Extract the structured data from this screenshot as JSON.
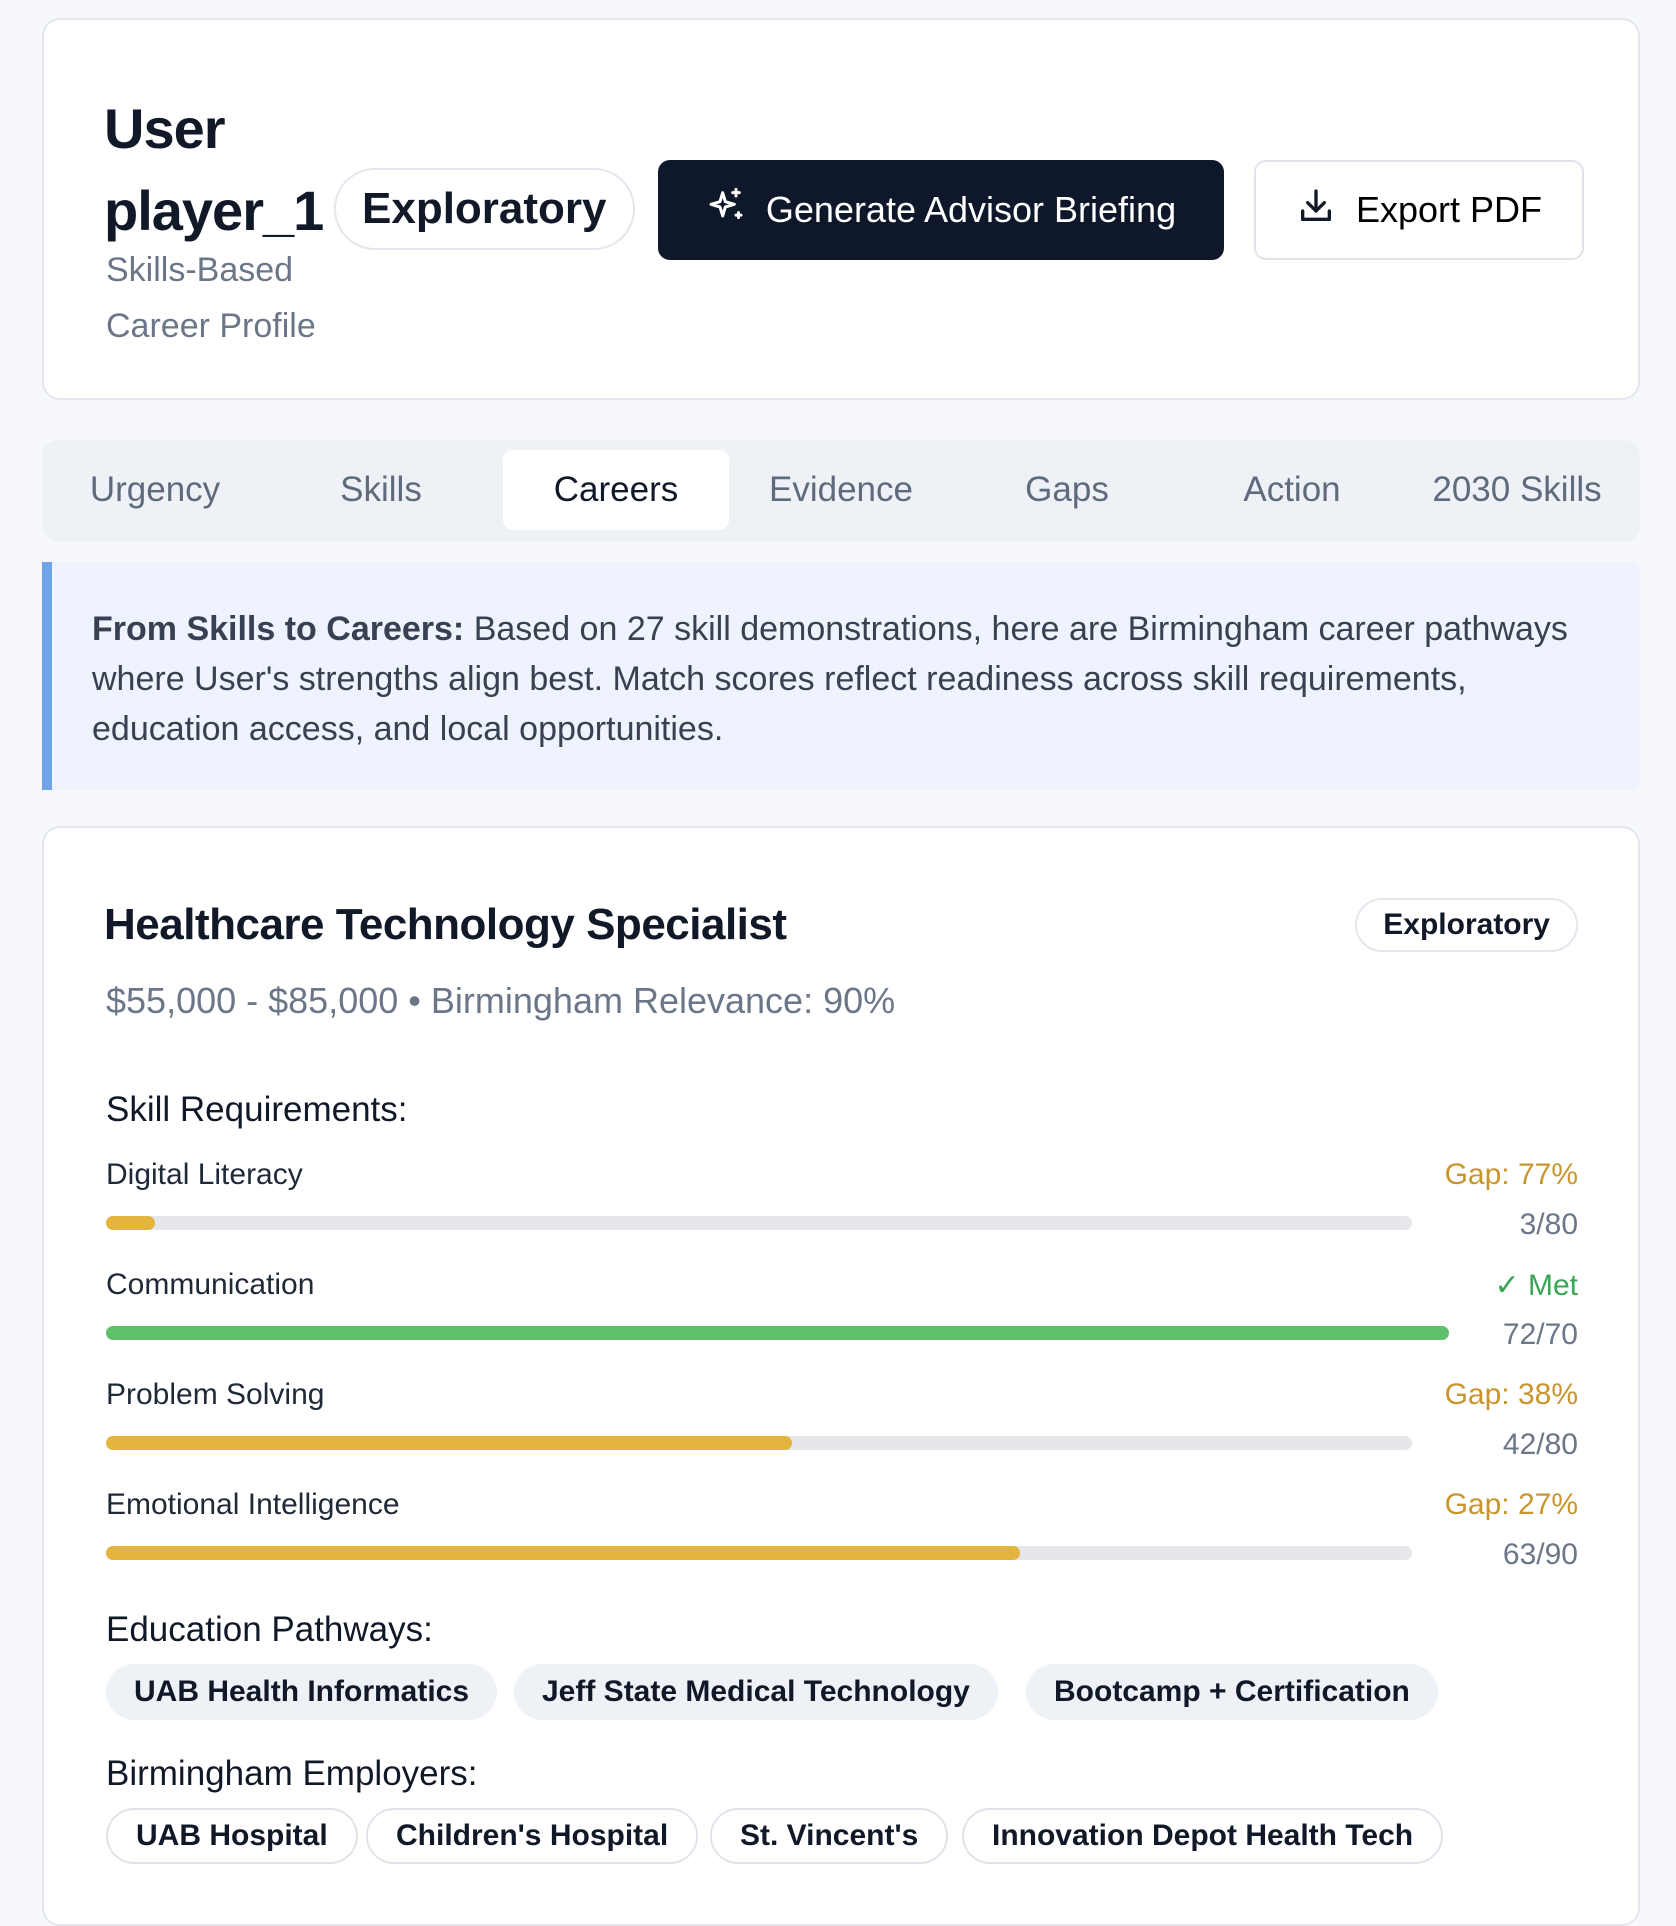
{
  "header": {
    "title_line1": "User",
    "title_line2": "player_1",
    "subtitle_line1": "Skills-Based",
    "subtitle_line2": "Career Profile",
    "mode_badge": "Exploratory",
    "generate_button": "Generate Advisor Briefing",
    "export_button": "Export PDF",
    "generate_icon": "sparkles-icon",
    "export_icon": "download-icon"
  },
  "tabs": [
    {
      "label": "Urgency",
      "active": false
    },
    {
      "label": "Skills",
      "active": false
    },
    {
      "label": "Careers",
      "active": true
    },
    {
      "label": "Evidence",
      "active": false
    },
    {
      "label": "Gaps",
      "active": false
    },
    {
      "label": "Action",
      "active": false
    },
    {
      "label": "2030 Skills",
      "active": false
    }
  ],
  "note": {
    "lead": "From Skills to Careers:",
    "body": "Based on 27 skill demonstrations, here are Birmingham career pathways where User's strengths align best. Match scores reflect readiness across skill requirements, education access, and local opportunities.",
    "accent_color": "#6fa3ea"
  },
  "career": {
    "title": "Healthcare Technology Specialist",
    "badge": "Exploratory",
    "salary": "$55,000 - $85,000",
    "separator": "•",
    "relevance": "Birmingham Relevance: 90%",
    "skills_label": "Skill Requirements:",
    "skills": [
      {
        "name": "Digital Literacy",
        "status": "Gap: 77%",
        "score": "3/80",
        "current": 3,
        "required": 80,
        "met": false
      },
      {
        "name": "Communication",
        "status": "✓ Met",
        "score": "72/70",
        "current": 72,
        "required": 70,
        "met": true
      },
      {
        "name": "Problem Solving",
        "status": "Gap: 38%",
        "score": "42/80",
        "current": 42,
        "required": 80,
        "met": false
      },
      {
        "name": "Emotional Intelligence",
        "status": "Gap: 27%",
        "score": "63/90",
        "current": 63,
        "required": 90,
        "met": false
      }
    ],
    "education_label": "Education Pathways:",
    "education": [
      "UAB Health Informatics",
      "Jeff State Medical Technology",
      "Bootcamp + Certification"
    ],
    "employers_label": "Birmingham Employers:",
    "employers": [
      "UAB Hospital",
      "Children's Hospital",
      "St. Vincent's",
      "Innovation Depot Health Tech"
    ]
  },
  "colors": {
    "gap": "#c9962e",
    "gap_bar": "#e3b53f",
    "met": "#3aa655",
    "met_bar": "#5fc06c",
    "primary_button": "#0f172a"
  }
}
